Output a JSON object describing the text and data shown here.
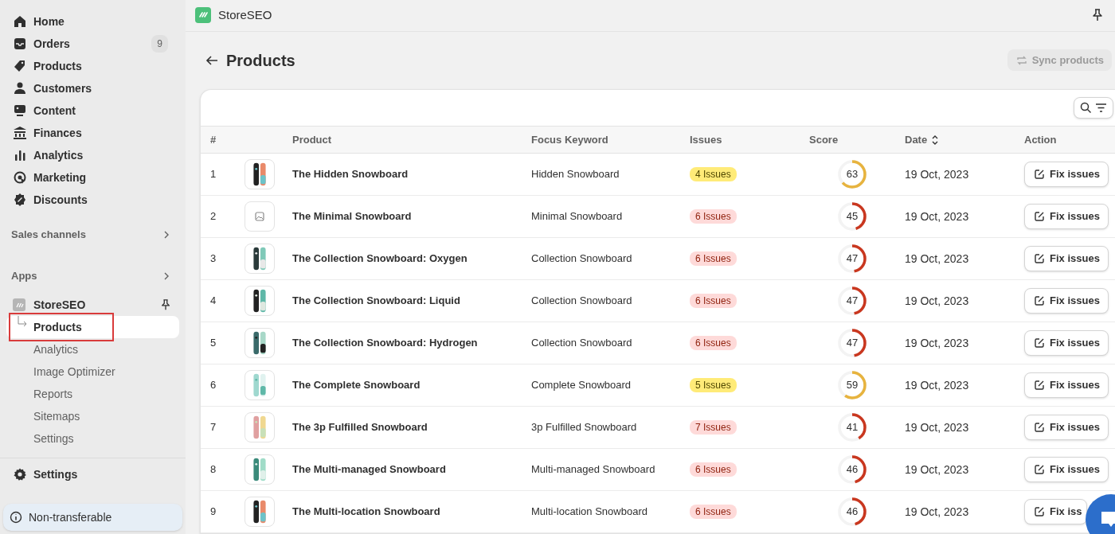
{
  "sidebar": {
    "nav": [
      {
        "kind": "home",
        "label": "Home"
      },
      {
        "kind": "orders",
        "label": "Orders",
        "badge": "9"
      },
      {
        "kind": "tag",
        "label": "Products"
      },
      {
        "kind": "person",
        "label": "Customers"
      },
      {
        "kind": "content",
        "label": "Content"
      },
      {
        "kind": "bank",
        "label": "Finances"
      },
      {
        "kind": "bars",
        "label": "Analytics"
      },
      {
        "kind": "target",
        "label": "Marketing"
      },
      {
        "kind": "discount",
        "label": "Discounts"
      }
    ],
    "sections": [
      {
        "label": "Sales channels"
      },
      {
        "label": "Apps"
      }
    ],
    "app": {
      "name": "StoreSEO",
      "items": [
        {
          "label": "Products",
          "selected": true
        },
        {
          "label": "Analytics",
          "selected": false
        },
        {
          "label": "Image Optimizer",
          "selected": false
        },
        {
          "label": "Reports",
          "selected": false
        },
        {
          "label": "Sitemaps",
          "selected": false
        },
        {
          "label": "Settings",
          "selected": false
        }
      ]
    },
    "settings": "Settings",
    "footer": "Non-transferable"
  },
  "topbar": {
    "title": "StoreSEO"
  },
  "page": {
    "title": "Products",
    "sync_button": {
      "label": "Sync products",
      "disabled": true
    }
  },
  "table": {
    "columns": [
      "#",
      "Product",
      "Focus Keyword",
      "Issues",
      "Score",
      "Date",
      "Action"
    ],
    "rows": [
      {
        "index": "1",
        "has_image": true,
        "product": "The Hidden Snowboard",
        "keyword": "Hidden Snowboard",
        "issues": "4 Issues",
        "kind": "warning",
        "score": "63",
        "level": 0.63,
        "date": "19 Oct, 2023",
        "action": "Fix issues"
      },
      {
        "index": "2",
        "has_image": false,
        "product": "The Minimal Snowboard",
        "keyword": "Minimal Snowboard",
        "issues": "6 Issues",
        "kind": "critical",
        "score": "45",
        "level": 0.45,
        "date": "19 Oct, 2023",
        "action": "Fix issues"
      },
      {
        "index": "3",
        "has_image": true,
        "product": "The Collection Snowboard: Oxygen",
        "keyword": "Collection Snowboard",
        "issues": "6 Issues",
        "kind": "critical",
        "score": "47",
        "level": 0.47,
        "date": "19 Oct, 2023",
        "action": "Fix issues"
      },
      {
        "index": "4",
        "has_image": true,
        "product": "The Collection Snowboard: Liquid",
        "keyword": "Collection Snowboard",
        "issues": "6 Issues",
        "kind": "critical",
        "score": "47",
        "level": 0.47,
        "date": "19 Oct, 2023",
        "action": "Fix issues"
      },
      {
        "index": "5",
        "has_image": true,
        "product": "The Collection Snowboard: Hydrogen",
        "keyword": "Collection Snowboard",
        "issues": "6 Issues",
        "kind": "critical",
        "score": "47",
        "level": 0.47,
        "date": "19 Oct, 2023",
        "action": "Fix issues"
      },
      {
        "index": "6",
        "has_image": true,
        "product": "The Complete Snowboard",
        "keyword": "Complete Snowboard",
        "issues": "5 Issues",
        "kind": "warning",
        "score": "59",
        "level": 0.59,
        "date": "19 Oct, 2023",
        "action": "Fix issues"
      },
      {
        "index": "7",
        "has_image": true,
        "product": "The 3p Fulfilled Snowboard",
        "keyword": "3p Fulfilled Snowboard",
        "issues": "7 Issues",
        "kind": "critical",
        "score": "41",
        "level": 0.41,
        "date": "19 Oct, 2023",
        "action": "Fix issues"
      },
      {
        "index": "8",
        "has_image": true,
        "product": "The Multi-managed Snowboard",
        "keyword": "Multi-managed Snowboard",
        "issues": "6 Issues",
        "kind": "critical",
        "score": "46",
        "level": 0.46,
        "date": "19 Oct, 2023",
        "action": "Fix issues"
      },
      {
        "index": "9",
        "has_image": true,
        "product": "The Multi-location Snowboard",
        "keyword": "Multi-location Snowboard",
        "issues": "6 Issues",
        "kind": "critical",
        "score": "46",
        "level": 0.46,
        "date": "19 Oct, 2023",
        "action": "Fix iss"
      }
    ]
  }
}
